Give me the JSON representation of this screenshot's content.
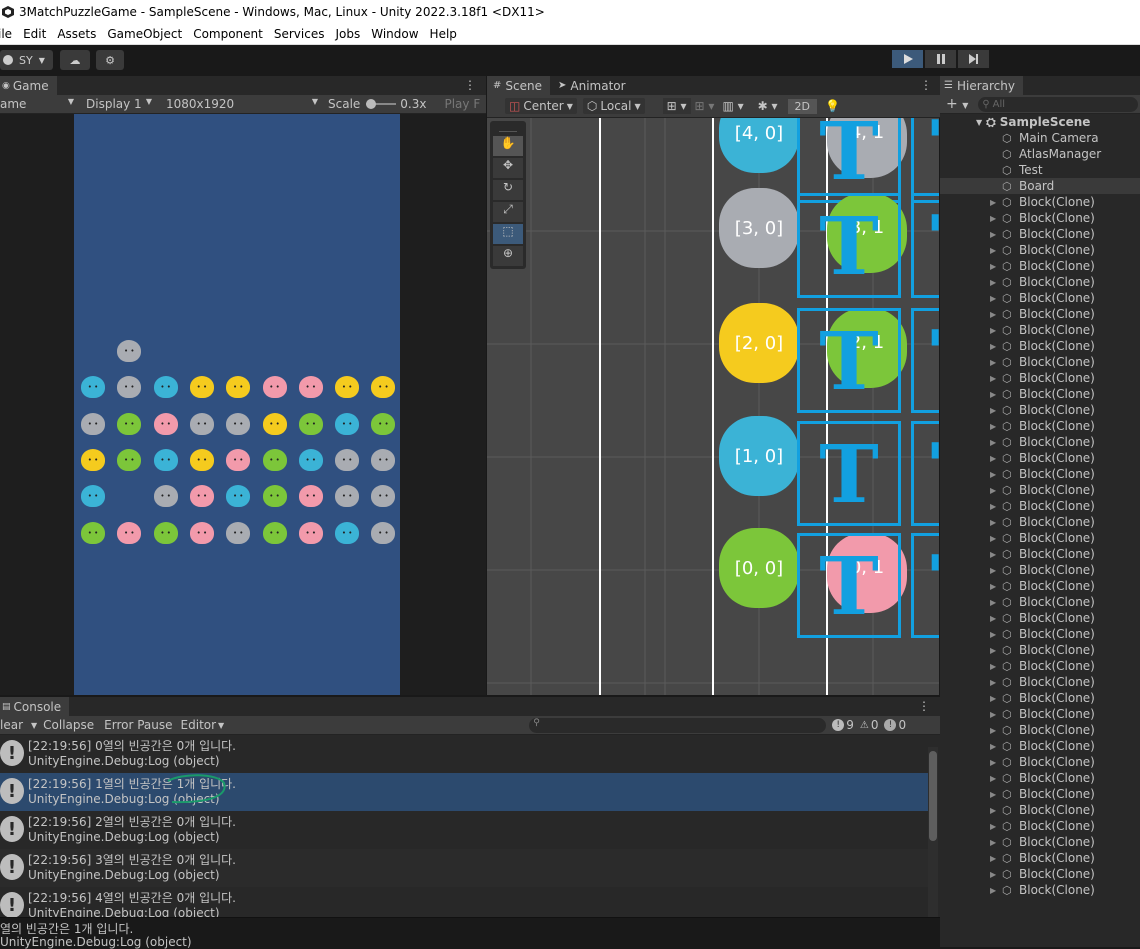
{
  "title": "3MatchPuzzleGame - SampleScene - Windows, Mac, Linux - Unity 2022.3.18f1 <DX11>",
  "menu": [
    "ile",
    "Edit",
    "Assets",
    "GameObject",
    "Component",
    "Services",
    "Jobs",
    "Window",
    "Help"
  ],
  "toolbar": {
    "account": "SY"
  },
  "game": {
    "tab": "Game",
    "mode": "ame",
    "display": "Display 1",
    "resolution": "1080x1920",
    "scale_label": "Scale",
    "scale_value": "0.3x",
    "play_focused": "Play F"
  },
  "scene": {
    "tabs": [
      "Scene",
      "Animator"
    ],
    "pivot": "Center",
    "space": "Local",
    "mode_2d": "2D",
    "labels": [
      "[4, 0]",
      "[3, 0]",
      "[2, 0]",
      "[1, 0]",
      "[0, 0]",
      "4, 1",
      "3, 1",
      "2, 1",
      "0, 1"
    ],
    "tmp_letter": "T",
    "cut_glyph": "'"
  },
  "hierarchy": {
    "tab": "Hierarchy",
    "search_placeholder": "All",
    "scene": "SampleScene",
    "items": [
      "Main Camera",
      "AtlasManager",
      "Test",
      "Board"
    ],
    "block": "Block(Clone)",
    "block_count": 44
  },
  "console": {
    "tab": "Console",
    "buttons": [
      "lear",
      "Collapse",
      "Error Pause",
      "Editor"
    ],
    "counts": {
      "log": "9",
      "warn": "0",
      "err": "0"
    },
    "logs": [
      {
        "msg": "[22:19:56] 0열의 빈공간은 0개 입니다.",
        "trace": "UnityEngine.Debug:Log (object)"
      },
      {
        "msg": "[22:19:56] 1열의 빈공간은 1개 입니다.",
        "trace": "UnityEngine.Debug:Log (object)"
      },
      {
        "msg": "[22:19:56] 2열의 빈공간은 0개 입니다.",
        "trace": "UnityEngine.Debug:Log (object)"
      },
      {
        "msg": "[22:19:56] 3열의 빈공간은 0개 입니다.",
        "trace": "UnityEngine.Debug:Log (object)"
      },
      {
        "msg": "[22:19:56] 4열의 빈공간은 0개 입니다.",
        "trace": "UnityEngine.Debug:Log (object)"
      }
    ],
    "status_msg": "열의 빈공간은 1개 입니다.",
    "status_trace": "UnityEngine.Debug:Log (object)"
  },
  "board_rows": [
    [
      "",
      "cat",
      "",
      "",
      "",
      "",
      "",
      "",
      ""
    ],
    [
      "dog",
      "cat",
      "dog",
      "chick",
      "chick",
      "pig",
      "pig",
      "chick",
      "chick"
    ],
    [
      "cat",
      "frog",
      "pig",
      "cat",
      "cat",
      "chick",
      "frog",
      "dog",
      "frog"
    ],
    [
      "chick",
      "frog",
      "dog",
      "chick",
      "pig",
      "frog",
      "dog",
      "cat",
      "cat"
    ],
    [
      "dog",
      "",
      "cat",
      "pig",
      "dog",
      "frog",
      "pig",
      "cat",
      "cat"
    ],
    [
      "frog",
      "pig",
      "frog",
      "pig",
      "cat",
      "frog",
      "pig",
      "dog",
      "cat"
    ]
  ],
  "colors": {
    "accent": "#3c5a7a",
    "board": "#305080",
    "highlight": "#2c4a6e"
  }
}
